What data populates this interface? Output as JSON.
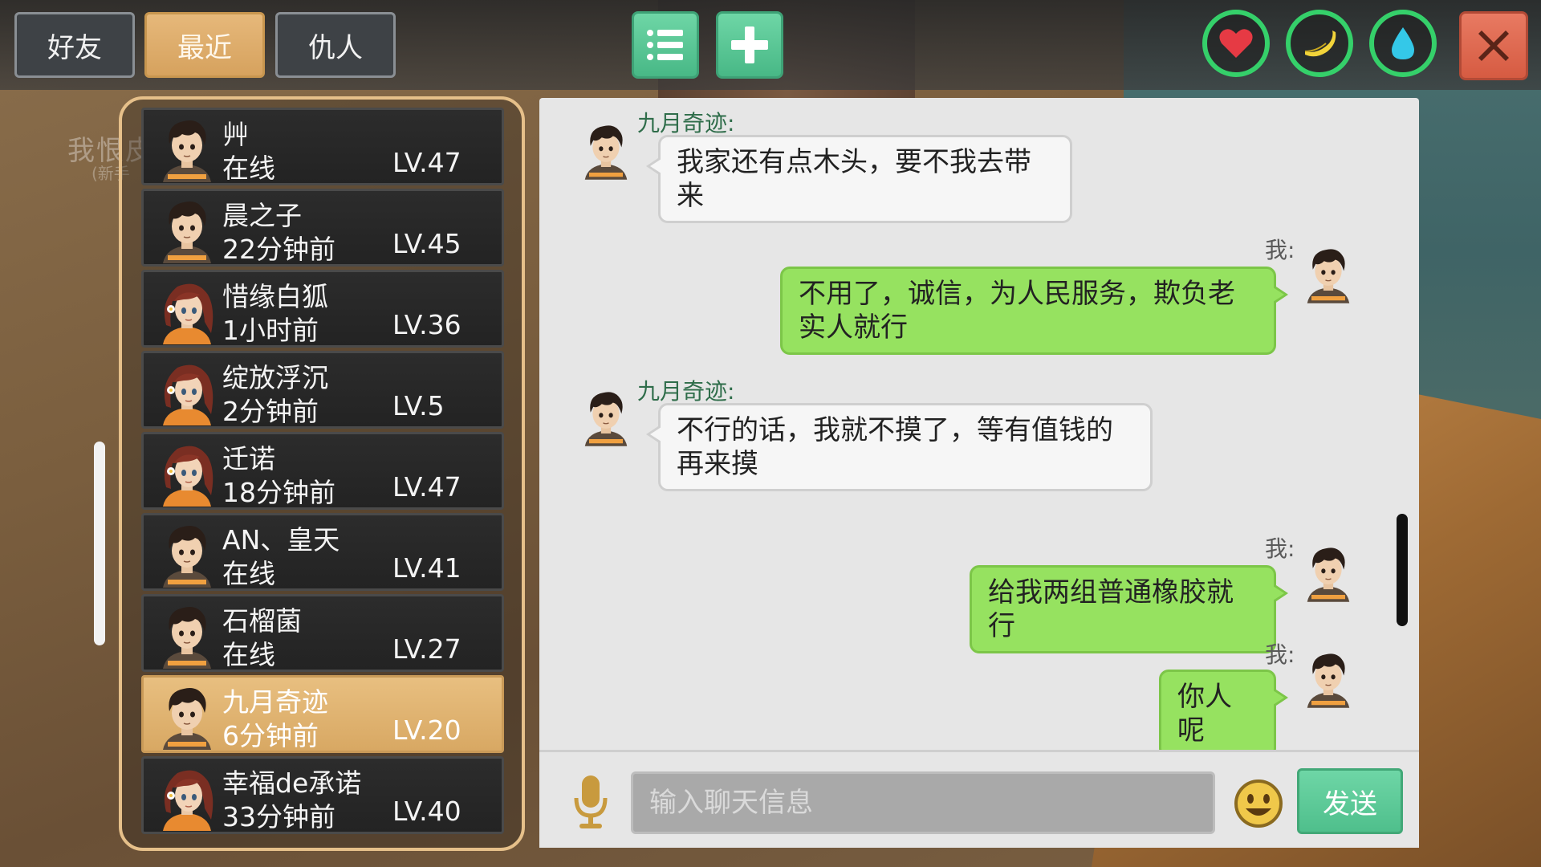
{
  "tabs": {
    "friends": "好友",
    "recent": "最近",
    "enemies": "仇人"
  },
  "icons": {
    "list": "list-icon",
    "add": "plus-icon",
    "health": "heart-icon",
    "hunger": "banana-icon",
    "thirst": "water-drop-icon",
    "close": "close-icon",
    "mic": "microphone-icon",
    "emoji": "smiley-icon"
  },
  "colors": {
    "accent": "#d8a863",
    "green_button": "#56c492",
    "status_ring": "#35d06a",
    "my_bubble": "#96e260",
    "close": "#d65b42"
  },
  "world": {
    "label": "我恨皮皮",
    "sublabel": "(新手"
  },
  "friends": [
    {
      "name": "艸",
      "status": "在线",
      "level": "LV.47",
      "avatar": "male"
    },
    {
      "name": "晨之子",
      "status": "22分钟前",
      "level": "LV.45",
      "avatar": "male"
    },
    {
      "name": "惜缘白狐",
      "status": "1小时前",
      "level": "LV.36",
      "avatar": "female"
    },
    {
      "name": "绽放浮沉",
      "status": "2分钟前",
      "level": "LV.5",
      "avatar": "female"
    },
    {
      "name": "迁诺",
      "status": "18分钟前",
      "level": "LV.47",
      "avatar": "female"
    },
    {
      "name": "AN、皇天",
      "status": "在线",
      "level": "LV.41",
      "avatar": "male"
    },
    {
      "name": "石榴菌",
      "status": "在线",
      "level": "LV.27",
      "avatar": "male"
    },
    {
      "name": "九月奇迹",
      "status": "6分钟前",
      "level": "LV.20",
      "avatar": "male",
      "selected": true
    },
    {
      "name": "幸福de承诺",
      "status": "33分钟前",
      "level": "LV.40",
      "avatar": "female"
    }
  ],
  "messages": [
    {
      "sender": "九月奇迹:",
      "from_me": false,
      "text": "我家还有点木头，要不我去带来"
    },
    {
      "sender": "我:",
      "from_me": true,
      "text": "不用了，诚信，为人民服务，欺负老实人就行"
    },
    {
      "sender": "九月奇迹:",
      "from_me": false,
      "text": "不行的话，我就不摸了，等有值钱的再来摸"
    },
    {
      "sender": "我:",
      "from_me": true,
      "text": "给我两组普通橡胶就行"
    },
    {
      "sender": "我:",
      "from_me": true,
      "text": "你人呢"
    }
  ],
  "input": {
    "placeholder": "输入聊天信息",
    "value": ""
  },
  "send_label": "发送"
}
